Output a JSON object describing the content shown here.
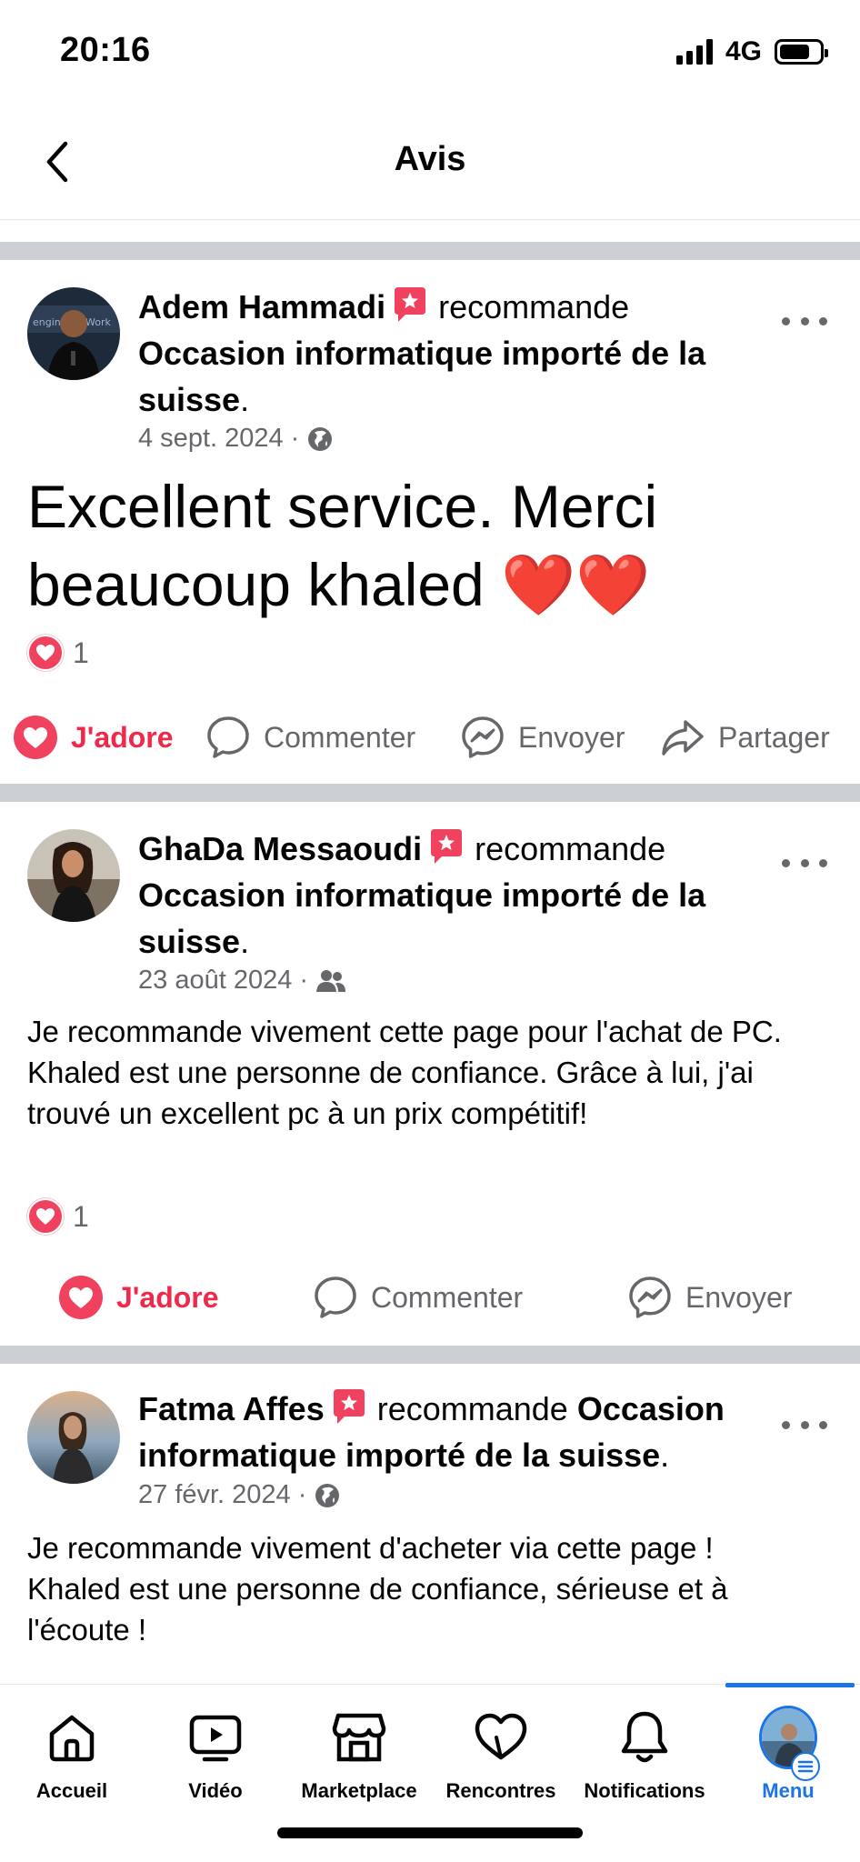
{
  "status_bar": {
    "time": "20:16",
    "network": "4G"
  },
  "header": {
    "title": "Avis"
  },
  "posts": [
    {
      "author": "Adem Hammadi",
      "verb": "recommande",
      "page": "Occasion informatique importé de la suisse",
      "date": "4 sept. 2024",
      "audience_icon": "globe-icon",
      "text": "Excellent service. Merci beaucoup khaled ❤️❤️",
      "reaction_count": "1",
      "actions": [
        "J'adore",
        "Commenter",
        "Envoyer",
        "Partager"
      ]
    },
    {
      "author": "GhaDa Messaoudi",
      "verb": "recommande",
      "page": "Occasion informatique importé de la suisse",
      "date": "23 août 2024",
      "audience_icon": "friends-icon",
      "text": "Je recommande vivement cette page pour l'achat de PC. Khaled est une personne de confiance. Grâce à lui, j'ai trouvé un excellent pc à un prix compétitif!",
      "reaction_count": "1",
      "actions": [
        "J'adore",
        "Commenter",
        "Envoyer"
      ]
    },
    {
      "author": "Fatma Affes",
      "verb": "recommande",
      "page": "Occasion informatique importé de la suisse",
      "date": "27 févr. 2024",
      "audience_icon": "globe-icon",
      "text_line1": "Je recommande vivement d'acheter via cette page !",
      "text_line2": "Khaled est une personne de confiance, sérieuse et à l'écoute !"
    }
  ],
  "nav": {
    "items": [
      "Accueil",
      "Vidéo",
      "Marketplace",
      "Rencontres",
      "Notifications",
      "Menu"
    ],
    "active": "Menu"
  },
  "colors": {
    "accent": "#1b74e4",
    "love": "#f0284a",
    "muted": "#65676b",
    "separator": "#ccd0d5"
  }
}
